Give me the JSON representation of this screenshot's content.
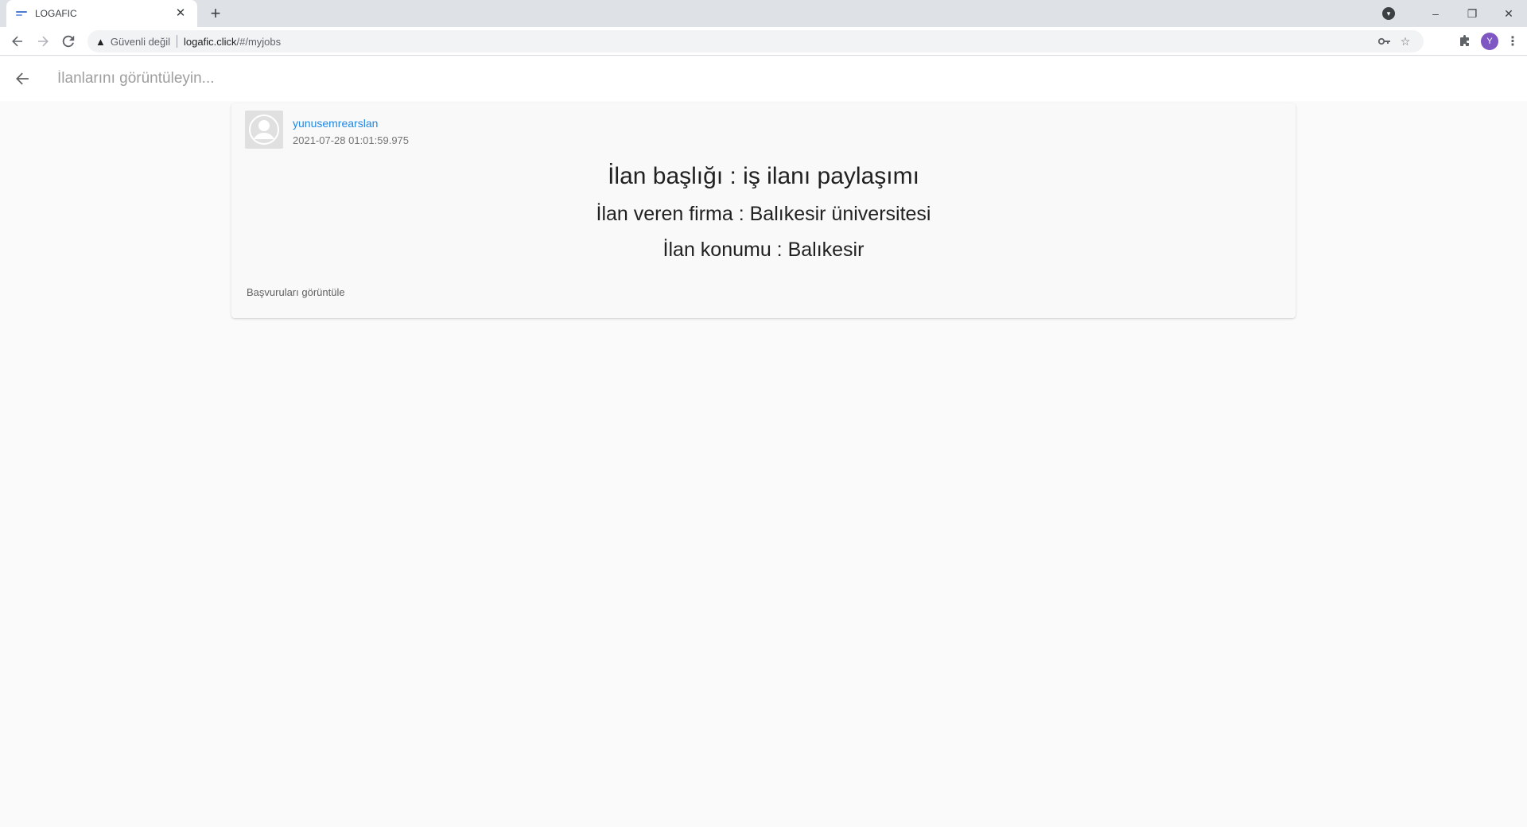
{
  "browser": {
    "tab": {
      "title": "LOGAFIC",
      "close_glyph": "✕",
      "favicon_color": "#4a7bd0"
    },
    "new_tab_glyph": "+",
    "window": {
      "minimize": "–",
      "maximize": "❐",
      "close": "✕"
    },
    "omnibox": {
      "security_label": "Güvenli değil",
      "url_host": "logafic.click",
      "url_path": "/#/myjobs"
    },
    "profile_initial": "Y",
    "profile_color": "#7e57c2"
  },
  "appbar": {
    "search_placeholder": "İlanlarını görüntüleyin..."
  },
  "job": {
    "username": "yunusemrearslan",
    "date": "2021-07-28 01:01:59.975",
    "title": "İlan başlığı : iş ilanı paylaşımı",
    "company": "İlan veren firma : Balıkesir üniversitesi",
    "location": "İlan konumu : Balıkesir",
    "action_label": "Başvuruları görüntüle",
    "username_color": "#1e88e5"
  }
}
